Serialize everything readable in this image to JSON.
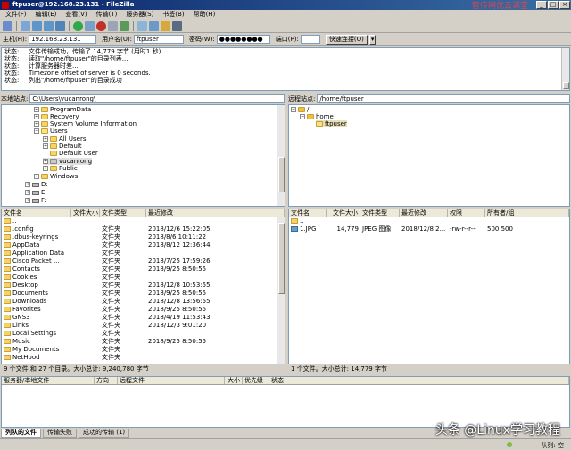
{
  "window": {
    "title": "ftpuser@192.168.23.131 - FileZilla",
    "watermark": "智传网优云课堂"
  },
  "menu": [
    "文件(F)",
    "编辑(E)",
    "查看(V)",
    "传输(T)",
    "服务器(S)",
    "书签(B)",
    "帮助(H)"
  ],
  "quickconnect": {
    "host_label": "主机(H):",
    "host": "192.168.23.131",
    "user_label": "用户名(U):",
    "user": "ftpuser",
    "pass_label": "密码(W):",
    "pass": "●●●●●●●●",
    "port_label": "端口(P):",
    "port": "",
    "connect": "快速连接(Q)"
  },
  "log": [
    {
      "label": "状态:",
      "text": "文件传输成功，传输了 14,779 字节 (用时1 秒)"
    },
    {
      "label": "状态:",
      "text": "读取\"/home/ftpuser\"的目录列表..."
    },
    {
      "label": "状态:",
      "text": "计算服务器时差..."
    },
    {
      "label": "状态:",
      "text": "Timezone offset of server is 0 seconds."
    },
    {
      "label": "状态:",
      "text": "列出\"/home/ftpuser\"的目录成功"
    }
  ],
  "local": {
    "site_label": "本地站点:",
    "path": "C:\\Users\\vucanrong\\",
    "tree": [
      "ProgramData",
      "Recovery",
      "System Volume Information",
      "Users",
      "All Users",
      "Default",
      "Default User",
      "vucanrong",
      "Public",
      "Windows",
      "D:",
      "E:",
      "F:"
    ],
    "headers": [
      "文件名",
      "文件大小",
      "文件类型",
      "最近修改"
    ],
    "files": [
      {
        "name": "..",
        "size": "",
        "type": "",
        "modified": ""
      },
      {
        "name": ".config",
        "size": "",
        "type": "文件夹",
        "modified": "2018/12/6 15:22:05"
      },
      {
        "name": ".dbus-keyrings",
        "size": "",
        "type": "文件夹",
        "modified": "2018/8/6 10:11:22"
      },
      {
        "name": "AppData",
        "size": "",
        "type": "文件夹",
        "modified": "2018/8/12 12:36:44"
      },
      {
        "name": "Application Data",
        "size": "",
        "type": "文件夹",
        "modified": ""
      },
      {
        "name": "Cisco Packet ...",
        "size": "",
        "type": "文件夹",
        "modified": "2018/7/25 17:59:26"
      },
      {
        "name": "Contacts",
        "size": "",
        "type": "文件夹",
        "modified": "2018/9/25 8:50:55"
      },
      {
        "name": "Cookies",
        "size": "",
        "type": "文件夹",
        "modified": ""
      },
      {
        "name": "Desktop",
        "size": "",
        "type": "文件夹",
        "modified": "2018/12/8 10:53:55"
      },
      {
        "name": "Documents",
        "size": "",
        "type": "文件夹",
        "modified": "2018/9/25 8:50:55"
      },
      {
        "name": "Downloads",
        "size": "",
        "type": "文件夹",
        "modified": "2018/12/8 13:56:55"
      },
      {
        "name": "Favorites",
        "size": "",
        "type": "文件夹",
        "modified": "2018/9/25 8:50:55"
      },
      {
        "name": "GNS3",
        "size": "",
        "type": "文件夹",
        "modified": "2018/4/19 11:53:43"
      },
      {
        "name": "Links",
        "size": "",
        "type": "文件夹",
        "modified": "2018/12/3 9:01:20"
      },
      {
        "name": "Local Settings",
        "size": "",
        "type": "文件夹",
        "modified": ""
      },
      {
        "name": "Music",
        "size": "",
        "type": "文件夹",
        "modified": "2018/9/25 8:50:55"
      },
      {
        "name": "My Documents",
        "size": "",
        "type": "文件夹",
        "modified": ""
      },
      {
        "name": "NetHood",
        "size": "",
        "type": "文件夹",
        "modified": ""
      }
    ],
    "status": "9 个文件 和 27 个目录。大小总计: 9,240,780 字节"
  },
  "remote": {
    "site_label": "远程站点:",
    "path": "/home/ftpuser",
    "tree": [
      "/",
      "home",
      "ftpuser"
    ],
    "headers": [
      "文件名",
      "文件大小",
      "文件类型",
      "最近修改",
      "权限",
      "所有者/组"
    ],
    "files": [
      {
        "name": "..",
        "size": "",
        "type": "",
        "modified": "",
        "perm": "",
        "owner": ""
      },
      {
        "name": "1.JPG",
        "size": "14,779",
        "type": "JPEG 图像",
        "modified": "2018/12/8 2...",
        "perm": "-rw-r--r--",
        "owner": "500 500"
      }
    ],
    "status": "1 个文件。大小总计: 14,779 字节"
  },
  "queue": {
    "headers": [
      "服务器/本地文件",
      "方向",
      "远程文件",
      "大小",
      "优先级",
      "状态"
    ],
    "tabs": [
      "列队的文件",
      "传输失败",
      "成功的传输 (1)"
    ],
    "status": "队列: 空"
  },
  "bottom_watermark": "头条 @Linux学习教程"
}
